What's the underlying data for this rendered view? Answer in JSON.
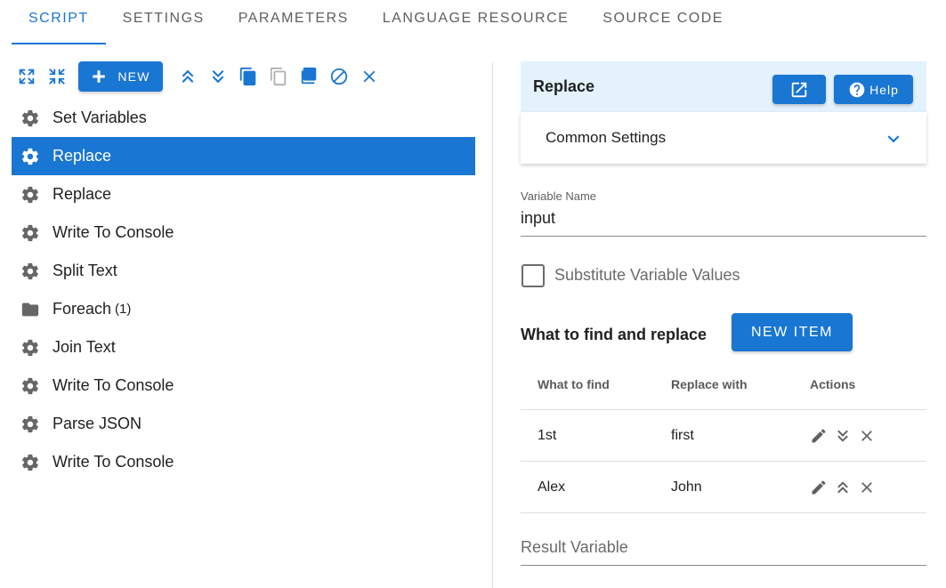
{
  "tabs": [
    {
      "label": "SCRIPT",
      "active": true
    },
    {
      "label": "SETTINGS",
      "active": false
    },
    {
      "label": "PARAMETERS",
      "active": false
    },
    {
      "label": "LANGUAGE RESOURCE",
      "active": false
    },
    {
      "label": "SOURCE CODE",
      "active": false
    }
  ],
  "toolbar": {
    "new_label": "NEW",
    "icons": [
      "expand-all-icon",
      "collapse-all-icon",
      "new-icon",
      "move-up-icon",
      "move-down-icon",
      "copy-icon",
      "paste-icon",
      "duplicate-icon",
      "disable-icon",
      "delete-icon"
    ]
  },
  "steps": [
    {
      "label": "Set Variables",
      "icon": "gear-icon",
      "selected": false
    },
    {
      "label": "Replace",
      "icon": "gear-icon",
      "selected": true
    },
    {
      "label": "Replace",
      "icon": "gear-icon",
      "selected": false
    },
    {
      "label": "Write To Console",
      "icon": "gear-icon",
      "selected": false
    },
    {
      "label": "Split Text",
      "icon": "gear-icon",
      "selected": false
    },
    {
      "label": "Foreach",
      "icon": "folder-icon",
      "selected": false,
      "count": "(1)"
    },
    {
      "label": "Join Text",
      "icon": "gear-icon",
      "selected": false
    },
    {
      "label": "Write To Console",
      "icon": "gear-icon",
      "selected": false
    },
    {
      "label": "Parse JSON",
      "icon": "gear-icon",
      "selected": false
    },
    {
      "label": "Write To Console",
      "icon": "gear-icon",
      "selected": false
    }
  ],
  "panel": {
    "title": "Replace",
    "help_label": "Help",
    "common_settings": "Common Settings",
    "variable_name_label": "Variable Name",
    "variable_name_value": "input",
    "substitute_label": "Substitute Variable Values",
    "substitute_checked": false,
    "section_title": "What to find and replace",
    "new_item_label": "NEW ITEM",
    "table": {
      "headers": [
        "What to find",
        "Replace with",
        "Actions"
      ],
      "rows": [
        {
          "find": "1st",
          "replace": "first",
          "move_icon": "move-down-icon"
        },
        {
          "find": "Alex",
          "replace": "John",
          "move_icon": "move-up-icon"
        }
      ]
    },
    "result_variable_label": "Result Variable"
  },
  "colors": {
    "accent": "#1976d2",
    "header_bg": "#e3f2fd"
  }
}
